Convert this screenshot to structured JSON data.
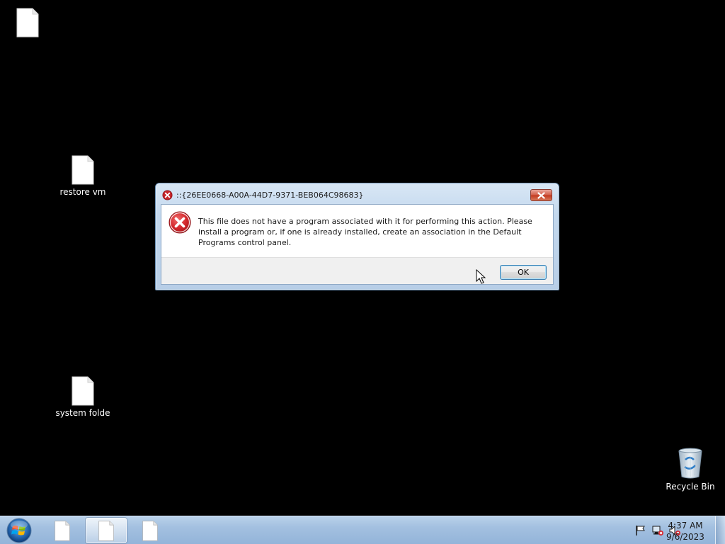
{
  "desktop": {
    "icons": [
      {
        "label": "",
        "icon": "document-icon"
      },
      {
        "label": "restore vm",
        "icon": "document-icon"
      },
      {
        "label": "system folde",
        "icon": "document-icon"
      },
      {
        "label": "Recycle Bin",
        "icon": "recycle-bin-icon"
      }
    ]
  },
  "dialog": {
    "title": "::{26EE0668-A00A-44D7-9371-BEB064C98683}",
    "message": "This file does not have a program associated with it for performing this action. Please install a program or, if one is already installed, create an association in the Default Programs control panel.",
    "ok_label": "OK",
    "icon": "error-icon"
  },
  "taskbar": {
    "buttons": [
      {
        "icon": "document-icon",
        "active": false
      },
      {
        "icon": "document-icon",
        "active": true
      },
      {
        "icon": "document-icon",
        "active": false
      }
    ],
    "tray_icons": [
      "action-center-flag-icon",
      "network-disconnected-icon",
      "volume-muted-icon"
    ],
    "clock": {
      "time": "4:37 AM",
      "date": "9/6/2023"
    }
  },
  "colors": {
    "desktop_background": "#000000",
    "error_red": "#c8262b",
    "taskbar": "#a3c0e0"
  }
}
